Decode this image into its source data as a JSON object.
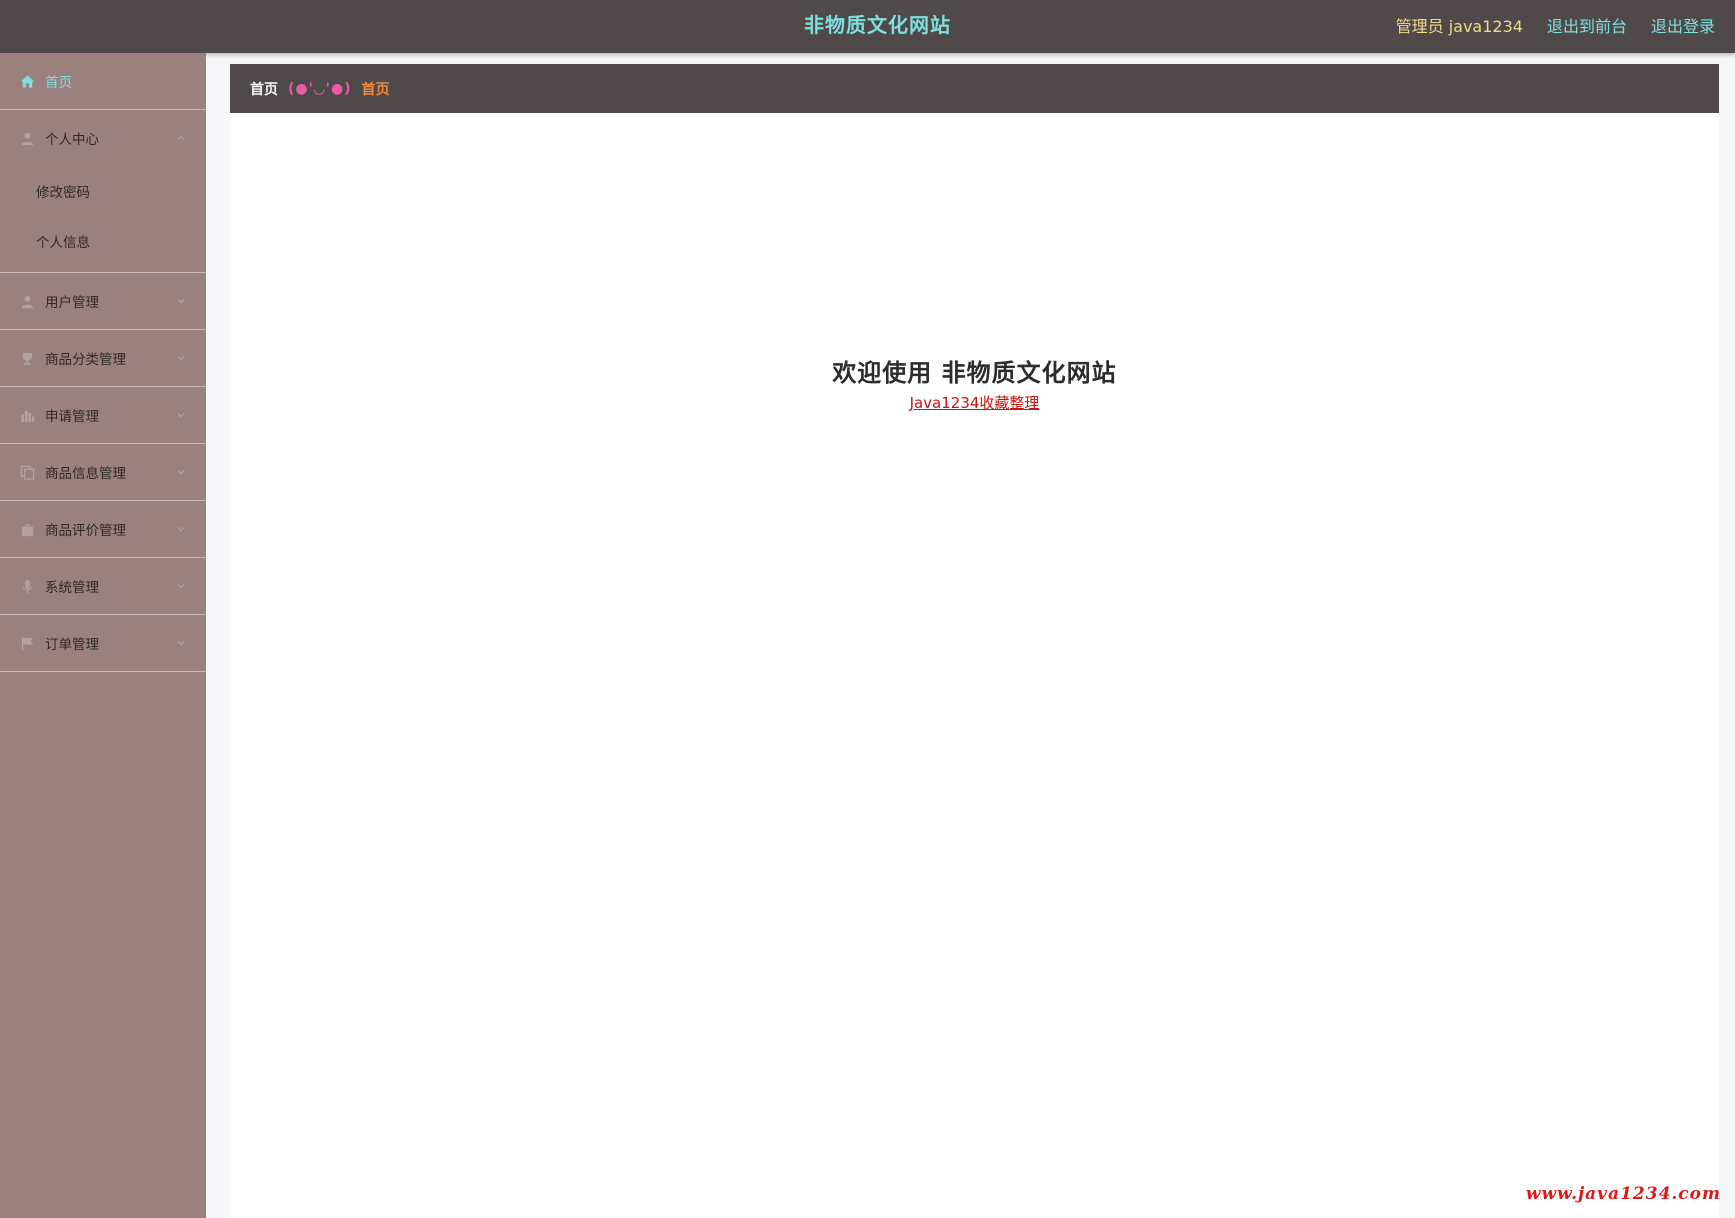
{
  "header": {
    "title": "非物质文化网站",
    "user_label": "管理员 java1234",
    "back_to_front": "退出到前台",
    "logout": "退出登录"
  },
  "sidebar": {
    "home": {
      "label": "首页",
      "icon": "home-icon"
    },
    "personal_center": {
      "label": "个人中心",
      "icon": "user-icon",
      "children": [
        {
          "label": "修改密码"
        },
        {
          "label": "个人信息"
        }
      ]
    },
    "items": [
      {
        "label": "用户管理",
        "icon": "user-icon"
      },
      {
        "label": "商品分类管理",
        "icon": "trophy-icon"
      },
      {
        "label": "申请管理",
        "icon": "chart-icon"
      },
      {
        "label": "商品信息管理",
        "icon": "copy-icon"
      },
      {
        "label": "商品评价管理",
        "icon": "bag-icon"
      },
      {
        "label": "系统管理",
        "icon": "mic-icon"
      },
      {
        "label": "订单管理",
        "icon": "flag-icon"
      }
    ]
  },
  "breadcrumb": {
    "home": "首页",
    "separator": "(●'◡'●)",
    "current": "首页"
  },
  "main": {
    "welcome_title": "欢迎使用 非物质文化网站",
    "welcome_link": "Java1234收藏整理"
  },
  "watermark": "www.java1234.com",
  "colors": {
    "topbar": "#4f494a",
    "sidebar": "#9b8080",
    "accent": "#7ee0de",
    "user_label": "#f1d98a",
    "breadcrumb_current": "#f08a3c",
    "link": "#cc1111"
  }
}
